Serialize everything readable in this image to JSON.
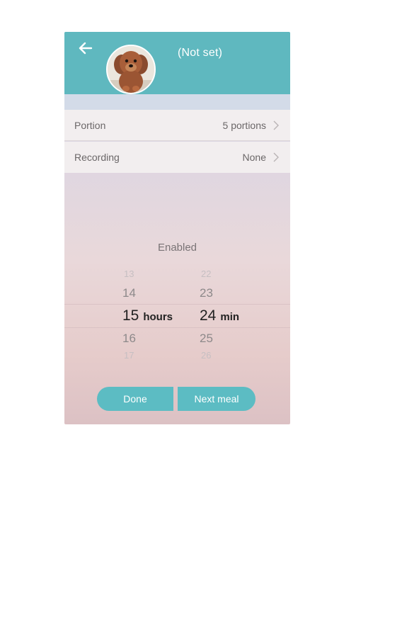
{
  "header": {
    "pet_name": "(Not set)",
    "back_icon": "arrow-left-icon",
    "avatar": "pet-avatar-dog-photo"
  },
  "settings": {
    "portion": {
      "label": "Portion",
      "value": "5 portions"
    },
    "recording": {
      "label": "Recording",
      "value": "None"
    }
  },
  "schedule": {
    "status": "Enabled",
    "hours": {
      "prev2": "13",
      "prev1": "14",
      "selected": "15",
      "next1": "16",
      "next2": "17",
      "unit": "hours"
    },
    "minutes": {
      "prev2": "22",
      "prev1": "23",
      "selected": "24",
      "next1": "25",
      "next2": "26",
      "unit": "min"
    }
  },
  "actions": {
    "done_label": "Done",
    "next_label": "Next meal"
  },
  "colors": {
    "accent": "#5fb8bf",
    "row_background": "#f2eeef"
  }
}
